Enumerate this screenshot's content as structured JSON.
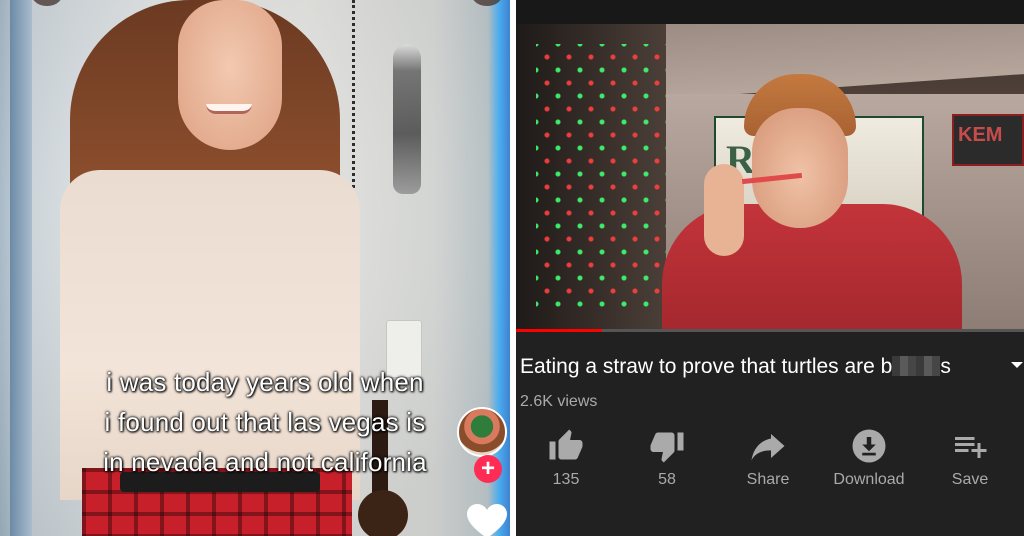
{
  "left_panel": {
    "caption_lines": [
      "i was today years old when",
      "i found out that las vegas is",
      "in nevada and not california"
    ],
    "follow_symbol": "+"
  },
  "right_panel": {
    "video": {
      "progress_fraction": 0.17
    },
    "title_before": "Eating a straw to prove that turtles are b",
    "title_after": "s",
    "views": "2.6K views",
    "actions": [
      {
        "icon": "thumbs-up-icon",
        "label": "135"
      },
      {
        "icon": "thumbs-down-icon",
        "label": "58"
      },
      {
        "icon": "share-icon",
        "label": "Share"
      },
      {
        "icon": "download-icon",
        "label": "Download"
      },
      {
        "icon": "save-icon",
        "label": "Save"
      }
    ]
  },
  "colors": {
    "youtube_bg": "#212121",
    "progress_red": "#ff0000",
    "tiktok_follow": "#fe2c55"
  }
}
